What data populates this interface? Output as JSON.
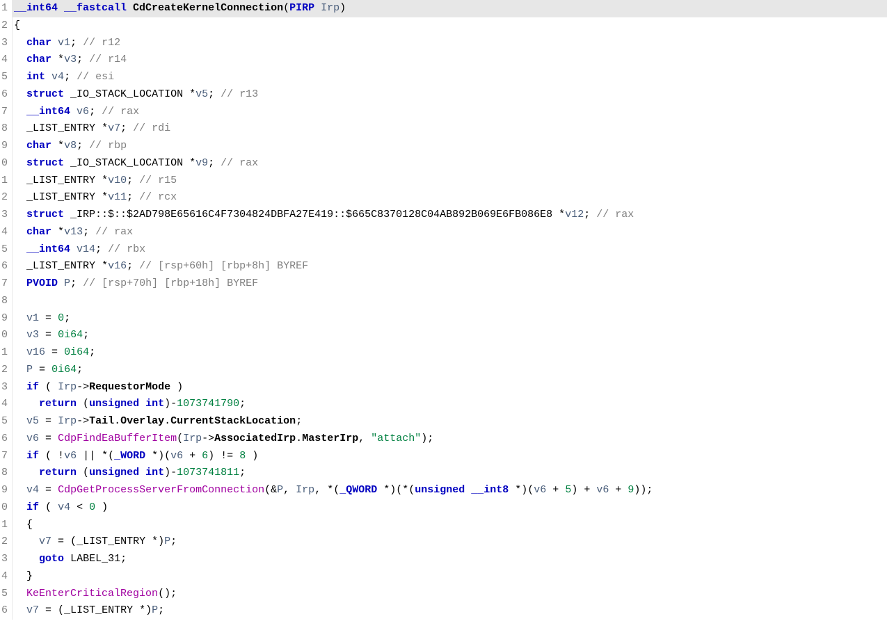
{
  "lines": [
    {
      "n": "1",
      "highlight": true,
      "tokens": [
        {
          "t": "__int64 __fastcall ",
          "c": "kw"
        },
        {
          "t": "CdCreateKernelConnection",
          "c": "fn"
        },
        {
          "t": "(",
          "c": "punct"
        },
        {
          "t": "PIRP ",
          "c": "kw"
        },
        {
          "t": "Irp",
          "c": "var"
        },
        {
          "t": ")",
          "c": "punct"
        }
      ]
    },
    {
      "n": "2",
      "tokens": [
        {
          "t": "{",
          "c": "punct"
        }
      ]
    },
    {
      "n": "3",
      "tokens": [
        {
          "t": "  ",
          "c": "plain"
        },
        {
          "t": "char ",
          "c": "kw"
        },
        {
          "t": "v1",
          "c": "var"
        },
        {
          "t": "; ",
          "c": "punct"
        },
        {
          "t": "// r12",
          "c": "comment"
        }
      ]
    },
    {
      "n": "4",
      "tokens": [
        {
          "t": "  ",
          "c": "plain"
        },
        {
          "t": "char ",
          "c": "kw"
        },
        {
          "t": "*",
          "c": "punct"
        },
        {
          "t": "v3",
          "c": "var"
        },
        {
          "t": "; ",
          "c": "punct"
        },
        {
          "t": "// r14",
          "c": "comment"
        }
      ]
    },
    {
      "n": "5",
      "tokens": [
        {
          "t": "  ",
          "c": "plain"
        },
        {
          "t": "int ",
          "c": "kw"
        },
        {
          "t": "v4",
          "c": "var"
        },
        {
          "t": "; ",
          "c": "punct"
        },
        {
          "t": "// esi",
          "c": "comment"
        }
      ]
    },
    {
      "n": "6",
      "tokens": [
        {
          "t": "  ",
          "c": "plain"
        },
        {
          "t": "struct ",
          "c": "kw"
        },
        {
          "t": "_IO_STACK_LOCATION ",
          "c": "plain"
        },
        {
          "t": "*",
          "c": "punct"
        },
        {
          "t": "v5",
          "c": "var"
        },
        {
          "t": "; ",
          "c": "punct"
        },
        {
          "t": "// r13",
          "c": "comment"
        }
      ]
    },
    {
      "n": "7",
      "tokens": [
        {
          "t": "  ",
          "c": "plain"
        },
        {
          "t": "__int64 ",
          "c": "kw"
        },
        {
          "t": "v6",
          "c": "var"
        },
        {
          "t": "; ",
          "c": "punct"
        },
        {
          "t": "// rax",
          "c": "comment"
        }
      ]
    },
    {
      "n": "8",
      "tokens": [
        {
          "t": "  ",
          "c": "plain"
        },
        {
          "t": "_LIST_ENTRY ",
          "c": "plain"
        },
        {
          "t": "*",
          "c": "punct"
        },
        {
          "t": "v7",
          "c": "var"
        },
        {
          "t": "; ",
          "c": "punct"
        },
        {
          "t": "// rdi",
          "c": "comment"
        }
      ]
    },
    {
      "n": "9",
      "tokens": [
        {
          "t": "  ",
          "c": "plain"
        },
        {
          "t": "char ",
          "c": "kw"
        },
        {
          "t": "*",
          "c": "punct"
        },
        {
          "t": "v8",
          "c": "var"
        },
        {
          "t": "; ",
          "c": "punct"
        },
        {
          "t": "// rbp",
          "c": "comment"
        }
      ]
    },
    {
      "n": "0",
      "tokens": [
        {
          "t": "  ",
          "c": "plain"
        },
        {
          "t": "struct ",
          "c": "kw"
        },
        {
          "t": "_IO_STACK_LOCATION ",
          "c": "plain"
        },
        {
          "t": "*",
          "c": "punct"
        },
        {
          "t": "v9",
          "c": "var"
        },
        {
          "t": "; ",
          "c": "punct"
        },
        {
          "t": "// rax",
          "c": "comment"
        }
      ]
    },
    {
      "n": "1",
      "tokens": [
        {
          "t": "  ",
          "c": "plain"
        },
        {
          "t": "_LIST_ENTRY ",
          "c": "plain"
        },
        {
          "t": "*",
          "c": "punct"
        },
        {
          "t": "v10",
          "c": "var"
        },
        {
          "t": "; ",
          "c": "punct"
        },
        {
          "t": "// r15",
          "c": "comment"
        }
      ]
    },
    {
      "n": "2",
      "tokens": [
        {
          "t": "  ",
          "c": "plain"
        },
        {
          "t": "_LIST_ENTRY ",
          "c": "plain"
        },
        {
          "t": "*",
          "c": "punct"
        },
        {
          "t": "v11",
          "c": "var"
        },
        {
          "t": "; ",
          "c": "punct"
        },
        {
          "t": "// rcx",
          "c": "comment"
        }
      ]
    },
    {
      "n": "3",
      "tokens": [
        {
          "t": "  ",
          "c": "plain"
        },
        {
          "t": "struct ",
          "c": "kw"
        },
        {
          "t": "_IRP::$::$2AD798E65616C4F7304824DBFA27E419::$665C8370128C04AB892B069E6FB086E8 ",
          "c": "plain"
        },
        {
          "t": "*",
          "c": "punct"
        },
        {
          "t": "v12",
          "c": "var"
        },
        {
          "t": "; ",
          "c": "punct"
        },
        {
          "t": "// rax",
          "c": "comment"
        }
      ]
    },
    {
      "n": "4",
      "tokens": [
        {
          "t": "  ",
          "c": "plain"
        },
        {
          "t": "char ",
          "c": "kw"
        },
        {
          "t": "*",
          "c": "punct"
        },
        {
          "t": "v13",
          "c": "var"
        },
        {
          "t": "; ",
          "c": "punct"
        },
        {
          "t": "// rax",
          "c": "comment"
        }
      ]
    },
    {
      "n": "5",
      "tokens": [
        {
          "t": "  ",
          "c": "plain"
        },
        {
          "t": "__int64 ",
          "c": "kw"
        },
        {
          "t": "v14",
          "c": "var"
        },
        {
          "t": "; ",
          "c": "punct"
        },
        {
          "t": "// rbx",
          "c": "comment"
        }
      ]
    },
    {
      "n": "6",
      "tokens": [
        {
          "t": "  ",
          "c": "plain"
        },
        {
          "t": "_LIST_ENTRY ",
          "c": "plain"
        },
        {
          "t": "*",
          "c": "punct"
        },
        {
          "t": "v16",
          "c": "var"
        },
        {
          "t": "; ",
          "c": "punct"
        },
        {
          "t": "// [rsp+60h] [rbp+8h] BYREF",
          "c": "comment"
        }
      ]
    },
    {
      "n": "7",
      "tokens": [
        {
          "t": "  ",
          "c": "plain"
        },
        {
          "t": "PVOID ",
          "c": "kw"
        },
        {
          "t": "P",
          "c": "var"
        },
        {
          "t": "; ",
          "c": "punct"
        },
        {
          "t": "// [rsp+70h] [rbp+18h] BYREF",
          "c": "comment"
        }
      ]
    },
    {
      "n": "8",
      "tokens": [
        {
          "t": " ",
          "c": "plain"
        }
      ]
    },
    {
      "n": "9",
      "tokens": [
        {
          "t": "  ",
          "c": "plain"
        },
        {
          "t": "v1",
          "c": "var"
        },
        {
          "t": " = ",
          "c": "punct"
        },
        {
          "t": "0",
          "c": "num"
        },
        {
          "t": ";",
          "c": "punct"
        }
      ]
    },
    {
      "n": "0",
      "tokens": [
        {
          "t": "  ",
          "c": "plain"
        },
        {
          "t": "v3",
          "c": "var"
        },
        {
          "t": " = ",
          "c": "punct"
        },
        {
          "t": "0i64",
          "c": "num"
        },
        {
          "t": ";",
          "c": "punct"
        }
      ]
    },
    {
      "n": "1",
      "tokens": [
        {
          "t": "  ",
          "c": "plain"
        },
        {
          "t": "v16",
          "c": "var"
        },
        {
          "t": " = ",
          "c": "punct"
        },
        {
          "t": "0i64",
          "c": "num"
        },
        {
          "t": ";",
          "c": "punct"
        }
      ]
    },
    {
      "n": "2",
      "tokens": [
        {
          "t": "  ",
          "c": "plain"
        },
        {
          "t": "P",
          "c": "var"
        },
        {
          "t": " = ",
          "c": "punct"
        },
        {
          "t": "0i64",
          "c": "num"
        },
        {
          "t": ";",
          "c": "punct"
        }
      ]
    },
    {
      "n": "3",
      "tokens": [
        {
          "t": "  ",
          "c": "plain"
        },
        {
          "t": "if",
          "c": "kw"
        },
        {
          "t": " ( ",
          "c": "punct"
        },
        {
          "t": "Irp",
          "c": "var"
        },
        {
          "t": "->",
          "c": "punct"
        },
        {
          "t": "RequestorMode",
          "c": "field"
        },
        {
          "t": " )",
          "c": "punct"
        }
      ]
    },
    {
      "n": "4",
      "tokens": [
        {
          "t": "    ",
          "c": "plain"
        },
        {
          "t": "return",
          "c": "kw"
        },
        {
          "t": " (",
          "c": "punct"
        },
        {
          "t": "unsigned int",
          "c": "kw"
        },
        {
          "t": ")",
          "c": "punct"
        },
        {
          "t": "-",
          "c": "punct"
        },
        {
          "t": "1073741790",
          "c": "num"
        },
        {
          "t": ";",
          "c": "punct"
        }
      ]
    },
    {
      "n": "5",
      "tokens": [
        {
          "t": "  ",
          "c": "plain"
        },
        {
          "t": "v5",
          "c": "var"
        },
        {
          "t": " = ",
          "c": "punct"
        },
        {
          "t": "Irp",
          "c": "var"
        },
        {
          "t": "->",
          "c": "punct"
        },
        {
          "t": "Tail",
          "c": "field"
        },
        {
          "t": ".",
          "c": "punct"
        },
        {
          "t": "Overlay",
          "c": "field"
        },
        {
          "t": ".",
          "c": "punct"
        },
        {
          "t": "CurrentStackLocation",
          "c": "field"
        },
        {
          "t": ";",
          "c": "punct"
        }
      ]
    },
    {
      "n": "6",
      "tokens": [
        {
          "t": "  ",
          "c": "plain"
        },
        {
          "t": "v6",
          "c": "var"
        },
        {
          "t": " = ",
          "c": "punct"
        },
        {
          "t": "CdpFindEaBufferItem",
          "c": "fncall"
        },
        {
          "t": "(",
          "c": "punct"
        },
        {
          "t": "Irp",
          "c": "var"
        },
        {
          "t": "->",
          "c": "punct"
        },
        {
          "t": "AssociatedIrp",
          "c": "field"
        },
        {
          "t": ".",
          "c": "punct"
        },
        {
          "t": "MasterIrp",
          "c": "field"
        },
        {
          "t": ", ",
          "c": "punct"
        },
        {
          "t": "\"attach\"",
          "c": "str"
        },
        {
          "t": ");",
          "c": "punct"
        }
      ]
    },
    {
      "n": "7",
      "tokens": [
        {
          "t": "  ",
          "c": "plain"
        },
        {
          "t": "if",
          "c": "kw"
        },
        {
          "t": " ( !",
          "c": "punct"
        },
        {
          "t": "v6",
          "c": "var"
        },
        {
          "t": " || *(",
          "c": "punct"
        },
        {
          "t": "_WORD",
          "c": "kw"
        },
        {
          "t": " *)(",
          "c": "punct"
        },
        {
          "t": "v6",
          "c": "var"
        },
        {
          "t": " + ",
          "c": "punct"
        },
        {
          "t": "6",
          "c": "num"
        },
        {
          "t": ") != ",
          "c": "punct"
        },
        {
          "t": "8",
          "c": "num"
        },
        {
          "t": " )",
          "c": "punct"
        }
      ]
    },
    {
      "n": "8",
      "tokens": [
        {
          "t": "    ",
          "c": "plain"
        },
        {
          "t": "return",
          "c": "kw"
        },
        {
          "t": " (",
          "c": "punct"
        },
        {
          "t": "unsigned int",
          "c": "kw"
        },
        {
          "t": ")",
          "c": "punct"
        },
        {
          "t": "-",
          "c": "punct"
        },
        {
          "t": "1073741811",
          "c": "num"
        },
        {
          "t": ";",
          "c": "punct"
        }
      ]
    },
    {
      "n": "9",
      "tokens": [
        {
          "t": "  ",
          "c": "plain"
        },
        {
          "t": "v4",
          "c": "var"
        },
        {
          "t": " = ",
          "c": "punct"
        },
        {
          "t": "CdpGetProcessServerFromConnection",
          "c": "fncall"
        },
        {
          "t": "(&",
          "c": "punct"
        },
        {
          "t": "P",
          "c": "var"
        },
        {
          "t": ", ",
          "c": "punct"
        },
        {
          "t": "Irp",
          "c": "var"
        },
        {
          "t": ", *(",
          "c": "punct"
        },
        {
          "t": "_QWORD",
          "c": "kw"
        },
        {
          "t": " *)(*(",
          "c": "punct"
        },
        {
          "t": "unsigned __int8",
          "c": "kw"
        },
        {
          "t": " *)(",
          "c": "punct"
        },
        {
          "t": "v6",
          "c": "var"
        },
        {
          "t": " + ",
          "c": "punct"
        },
        {
          "t": "5",
          "c": "num"
        },
        {
          "t": ") + ",
          "c": "punct"
        },
        {
          "t": "v6",
          "c": "var"
        },
        {
          "t": " + ",
          "c": "punct"
        },
        {
          "t": "9",
          "c": "num"
        },
        {
          "t": "));",
          "c": "punct"
        }
      ]
    },
    {
      "n": "0",
      "tokens": [
        {
          "t": "  ",
          "c": "plain"
        },
        {
          "t": "if",
          "c": "kw"
        },
        {
          "t": " ( ",
          "c": "punct"
        },
        {
          "t": "v4",
          "c": "var"
        },
        {
          "t": " < ",
          "c": "punct"
        },
        {
          "t": "0",
          "c": "num"
        },
        {
          "t": " )",
          "c": "punct"
        }
      ]
    },
    {
      "n": "1",
      "tokens": [
        {
          "t": "  {",
          "c": "punct"
        }
      ]
    },
    {
      "n": "2",
      "tokens": [
        {
          "t": "    ",
          "c": "plain"
        },
        {
          "t": "v7",
          "c": "var"
        },
        {
          "t": " = (",
          "c": "punct"
        },
        {
          "t": "_LIST_ENTRY",
          "c": "plain"
        },
        {
          "t": " *)",
          "c": "punct"
        },
        {
          "t": "P",
          "c": "var"
        },
        {
          "t": ";",
          "c": "punct"
        }
      ]
    },
    {
      "n": "3",
      "tokens": [
        {
          "t": "    ",
          "c": "plain"
        },
        {
          "t": "goto",
          "c": "kw"
        },
        {
          "t": " ",
          "c": "plain"
        },
        {
          "t": "LABEL_31",
          "c": "plain"
        },
        {
          "t": ";",
          "c": "punct"
        }
      ]
    },
    {
      "n": "4",
      "tokens": [
        {
          "t": "  }",
          "c": "punct"
        }
      ]
    },
    {
      "n": "5",
      "tokens": [
        {
          "t": "  ",
          "c": "plain"
        },
        {
          "t": "KeEnterCriticalRegion",
          "c": "fncall"
        },
        {
          "t": "();",
          "c": "punct"
        }
      ]
    },
    {
      "n": "6",
      "tokens": [
        {
          "t": "  ",
          "c": "plain"
        },
        {
          "t": "v7",
          "c": "var"
        },
        {
          "t": " = (",
          "c": "punct"
        },
        {
          "t": "_LIST_ENTRY",
          "c": "plain"
        },
        {
          "t": " *)",
          "c": "punct"
        },
        {
          "t": "P",
          "c": "var"
        },
        {
          "t": ";",
          "c": "punct"
        }
      ]
    }
  ]
}
